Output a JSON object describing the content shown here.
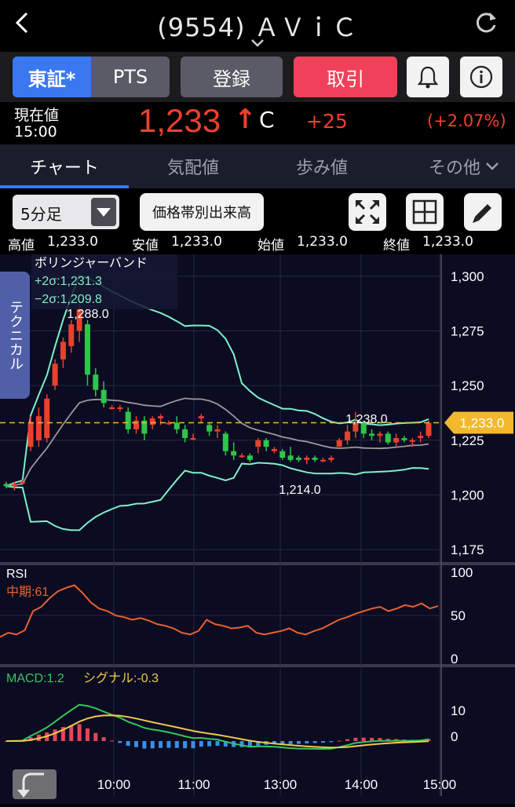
{
  "header": {
    "title": "(9554) ＡＶｉＣ",
    "back_icon": "chevron-left-icon",
    "refresh_icon": "refresh-icon"
  },
  "buttons": {
    "tse": "東証*",
    "pts": "PTS",
    "register": "登録",
    "trade": "取引",
    "bell_icon": "bell-icon",
    "info_icon": "info-icon"
  },
  "price": {
    "label_current": "現在値",
    "time": "15:00",
    "value": "1,233",
    "arrow": "↑",
    "flag": "C",
    "change": "+25",
    "change_pct": "(+2.07%)"
  },
  "tabs": [
    "チャート",
    "気配値",
    "歩み値",
    "その他"
  ],
  "toolbar": {
    "interval": "5分足",
    "volume_profile": "価格帯別出来高",
    "expand_icon": "expand-icon",
    "grid_icon": "grid-icon",
    "pencil_icon": "pencil-icon"
  },
  "ohlc": [
    {
      "label": "高値",
      "value": "1,233.0"
    },
    {
      "label": "安値",
      "value": "1,233.0"
    },
    {
      "label": "始値",
      "value": "1,233.0"
    },
    {
      "label": "終値",
      "value": "1,233.0"
    }
  ],
  "side_tab": "テクニカル",
  "colors": {
    "up": "#e8412e",
    "down": "#2ec54a",
    "accent_blue": "#3a78f2",
    "trade_red": "#f0405a",
    "upper_band": "#7ff0c8",
    "mid_band": "#9a9a9a",
    "rsi": "#e8612e",
    "macd": "#35c85a",
    "signal": "#f2c84a",
    "current_price": "#f2b82e"
  },
  "chart_data": [
    {
      "type": "candlestick",
      "title": "ボリンジャーバンド",
      "legend": [
        "+2σ:1,231.3",
        "−2σ:1,209.8"
      ],
      "y_ticks": [
        "1,300",
        "1,275",
        "1,250",
        "1,225",
        "1,200",
        "1,175"
      ],
      "ylim": [
        1170,
        1310
      ],
      "annotations": {
        "high": "1,288.0",
        "low": "1,214.0",
        "mid": "1,238.0"
      },
      "current_price_label": "1,233.0",
      "current_price": 1233,
      "candles": [
        [
          1205,
          1206,
          1203,
          1204
        ],
        [
          1204,
          1206,
          1202,
          1205
        ],
        [
          1206,
          1207,
          1205,
          1206
        ],
        [
          1222,
          1236,
          1220,
          1233
        ],
        [
          1225,
          1240,
          1222,
          1236
        ],
        [
          1226,
          1246,
          1224,
          1244
        ],
        [
          1250,
          1262,
          1248,
          1260
        ],
        [
          1262,
          1272,
          1258,
          1270
        ],
        [
          1268,
          1280,
          1265,
          1278
        ],
        [
          1275,
          1288,
          1270,
          1285
        ],
        [
          1278,
          1280,
          1250,
          1255
        ],
        [
          1255,
          1258,
          1245,
          1248
        ],
        [
          1248,
          1252,
          1240,
          1242
        ],
        [
          1240,
          1241,
          1239,
          1240
        ],
        [
          1240,
          1241,
          1238,
          1240
        ],
        [
          1238,
          1240,
          1228,
          1230
        ],
        [
          1230,
          1236,
          1228,
          1234
        ],
        [
          1234,
          1236,
          1225,
          1228
        ],
        [
          1232,
          1236,
          1230,
          1235
        ],
        [
          1235,
          1237,
          1232,
          1236
        ],
        [
          1233,
          1234,
          1232,
          1233
        ],
        [
          1233,
          1236,
          1228,
          1230
        ],
        [
          1230,
          1232,
          1224,
          1226
        ],
        [
          1226,
          1228,
          1225,
          1226
        ],
        [
          1235,
          1237,
          1233,
          1236
        ],
        [
          1232,
          1233,
          1227,
          1229
        ],
        [
          1229,
          1232,
          1226,
          1230
        ],
        [
          1228,
          1229,
          1218,
          1220
        ],
        [
          1220,
          1224,
          1216,
          1218
        ],
        [
          1218,
          1219,
          1217,
          1218
        ],
        [
          1218,
          1219,
          1215,
          1216
        ],
        [
          1222,
          1226,
          1219,
          1225
        ],
        [
          1225,
          1226,
          1220,
          1222
        ],
        [
          1220,
          1222,
          1219,
          1221
        ],
        [
          1220,
          1221,
          1216,
          1217
        ],
        [
          1218,
          1222,
          1215,
          1216
        ],
        [
          1217,
          1218,
          1215,
          1216
        ],
        [
          1216,
          1218,
          1214,
          1217
        ],
        [
          1217,
          1218,
          1215,
          1216
        ],
        [
          1216,
          1217,
          1215,
          1216
        ],
        [
          1216,
          1218,
          1215,
          1217
        ],
        [
          1222,
          1226,
          1222,
          1225
        ],
        [
          1225,
          1232,
          1223,
          1229
        ],
        [
          1229,
          1238,
          1226,
          1233
        ],
        [
          1233,
          1234,
          1226,
          1228
        ],
        [
          1228,
          1230,
          1225,
          1227
        ],
        [
          1227,
          1229,
          1224,
          1228
        ],
        [
          1228,
          1229,
          1223,
          1224
        ],
        [
          1224,
          1228,
          1222,
          1226
        ],
        [
          1226,
          1227,
          1224,
          1225
        ],
        [
          1225,
          1226,
          1222,
          1225
        ],
        [
          1226,
          1229,
          1224,
          1227
        ],
        [
          1227,
          1234,
          1226,
          1233
        ]
      ]
    },
    {
      "type": "line",
      "title": "RSI",
      "series": [
        {
          "name": "中期:61",
          "values": [
            25,
            30,
            28,
            33,
            55,
            60,
            70,
            78,
            82,
            85,
            76,
            65,
            58,
            55,
            50,
            48,
            45,
            47,
            44,
            40,
            38,
            35,
            30,
            28,
            32,
            45,
            40,
            38,
            35,
            36,
            38,
            30,
            28,
            30,
            32,
            35,
            30,
            28,
            32,
            35,
            40,
            45,
            48,
            52,
            55,
            58,
            60,
            55,
            58,
            62,
            60,
            64,
            58,
            61
          ]
        }
      ],
      "y_ticks": [
        "100",
        "50",
        "0"
      ],
      "ylim": [
        0,
        100
      ]
    },
    {
      "type": "macd",
      "title": "MACD",
      "series": [
        {
          "name": "MACD:1.2"
        },
        {
          "name": "シグナル:-0.3"
        }
      ],
      "y_ticks": [
        "10",
        "0"
      ],
      "x_ticks": [
        "10:00",
        "11:00",
        "13:00",
        "14:00",
        "15:00"
      ]
    }
  ]
}
